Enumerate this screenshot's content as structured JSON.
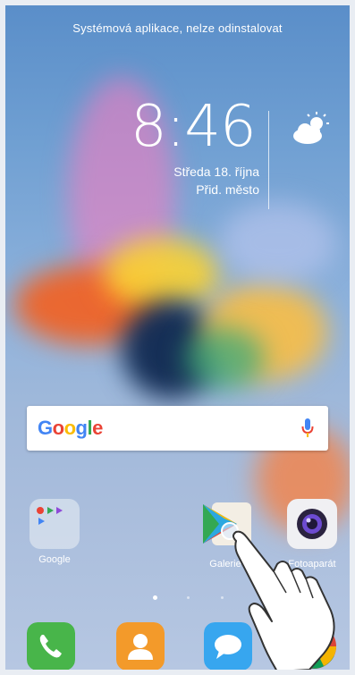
{
  "status": {
    "message": "Systémová aplikace, nelze odinstalovat"
  },
  "clock": {
    "time": "8:46",
    "date": "Středa 18. října",
    "location": "Přid. město"
  },
  "search": {
    "brand": "Google"
  },
  "apps": [
    {
      "label": "Google"
    },
    {
      "label": "Galerie"
    },
    {
      "label": "Fotoaparát"
    }
  ],
  "pager": {
    "total": 4,
    "current": 1
  },
  "colors": {
    "phone": "#48b54a",
    "contacts": "#f39a2a",
    "messages": "#37a6ef",
    "background": "#6f9fd2"
  },
  "icons": [
    "weather-icon",
    "mic-icon",
    "phone-icon",
    "contacts-icon",
    "messages-icon",
    "chrome-icon",
    "camera-icon",
    "play-store-icon",
    "gallery-icon",
    "hand-pointer-icon"
  ]
}
